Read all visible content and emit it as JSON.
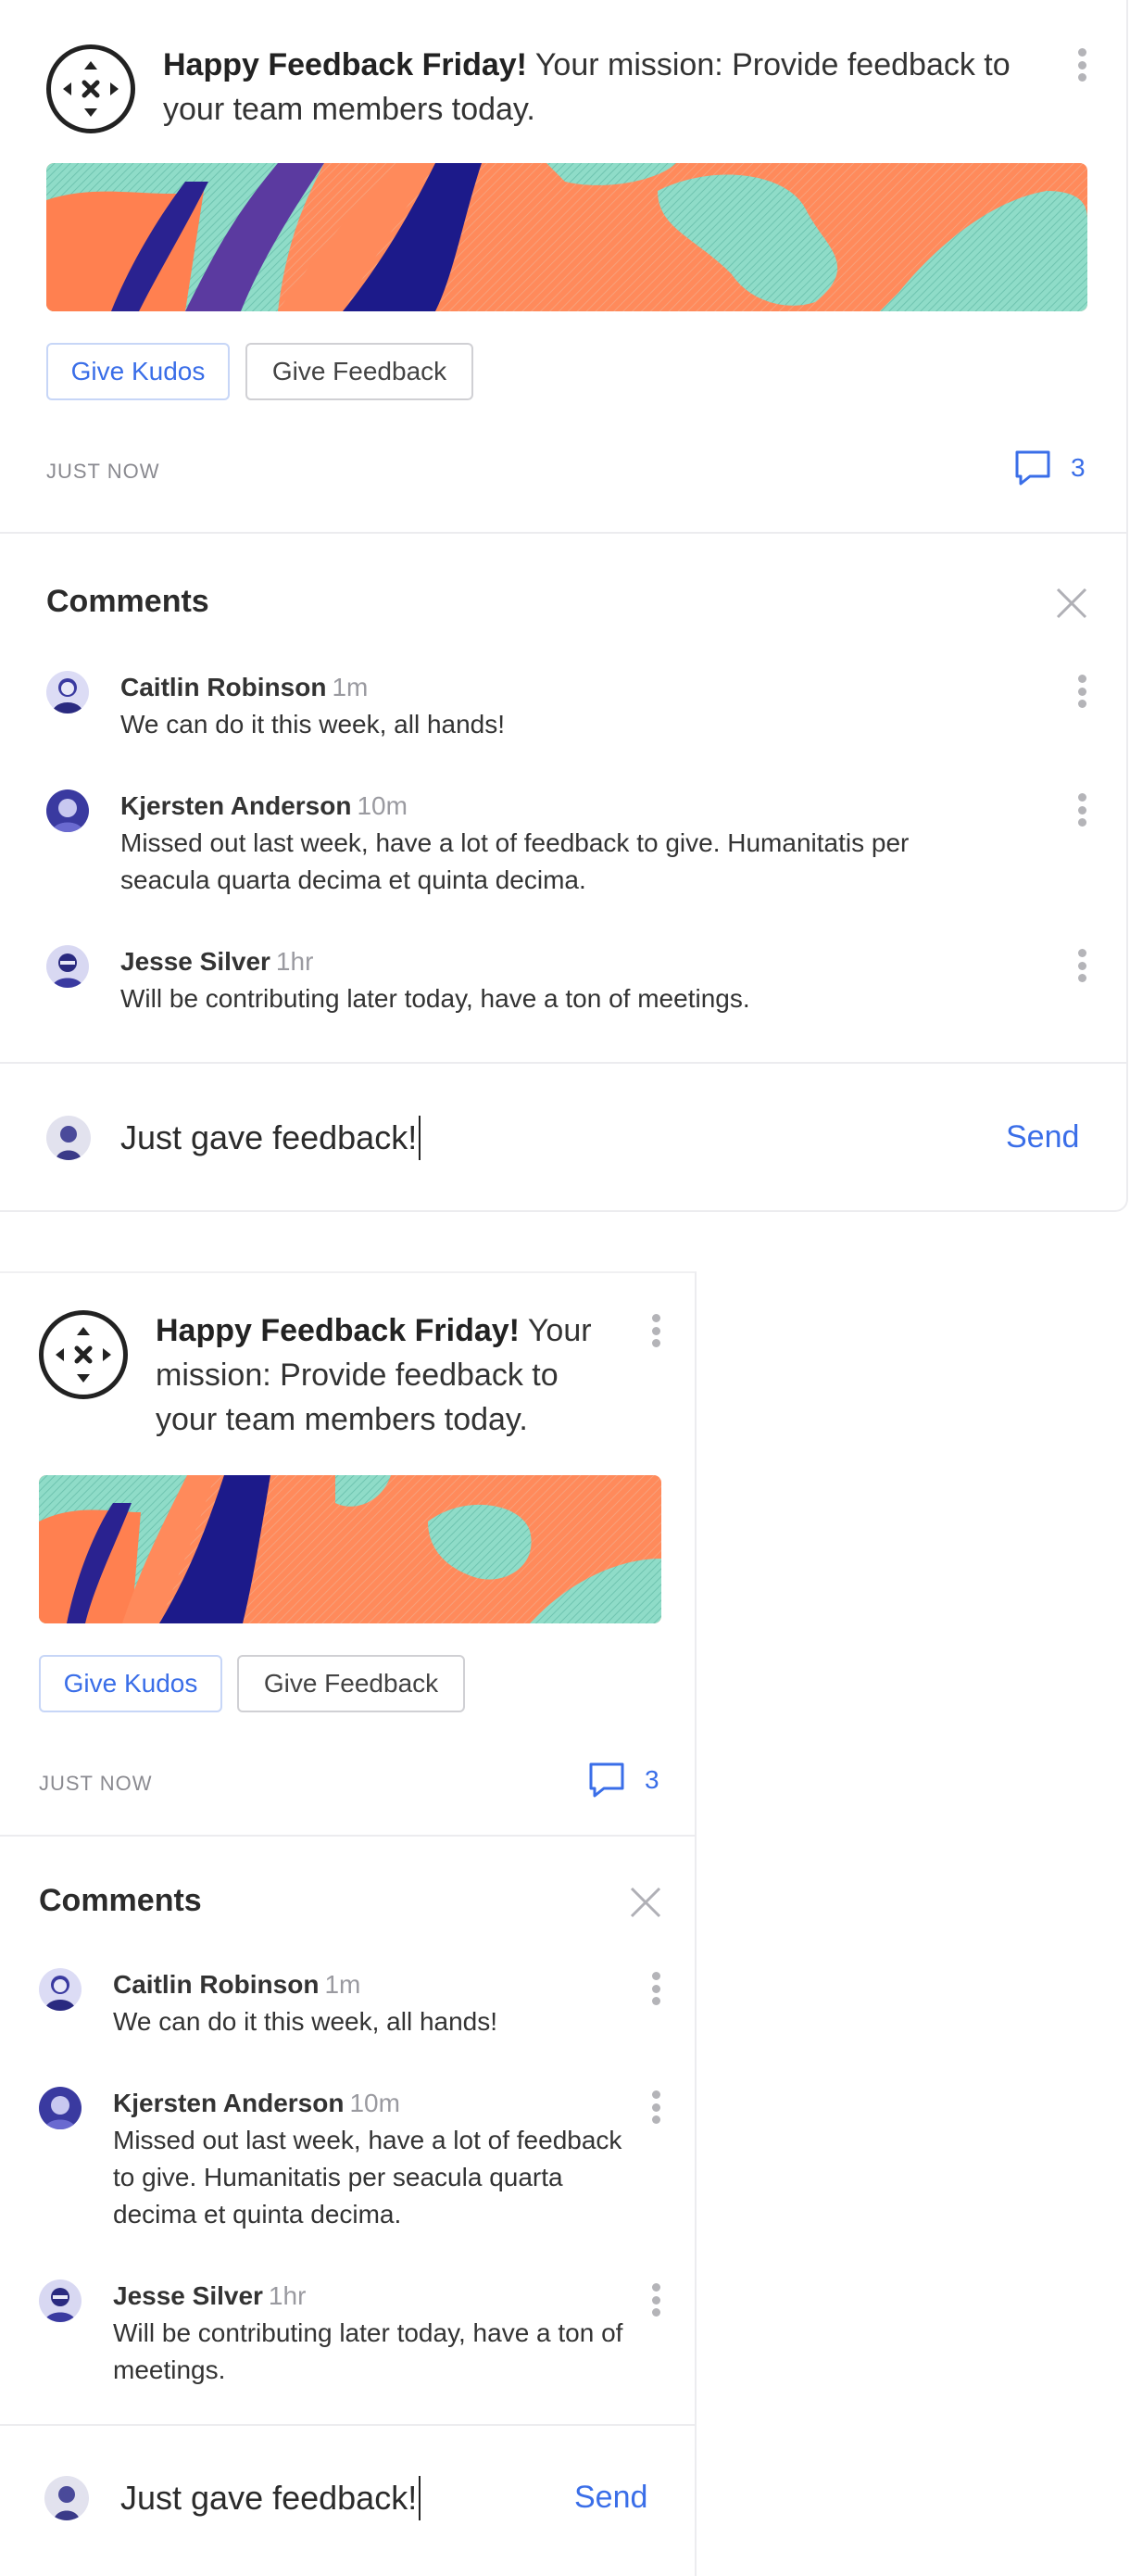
{
  "post": {
    "title_bold": "Happy Feedback Friday!",
    "title_rest": " Your mission: Provide feedback to your team members today.",
    "kudos_label": "Give Kudos",
    "feedback_label": "Give Feedback",
    "timestamp": "JUST NOW",
    "comment_count": "3",
    "logo_icon": "compass-arrows-icon",
    "comment_icon": "speech-bubble-icon",
    "menu_icon": "kebab-menu-icon"
  },
  "comments_panel": {
    "title": "Comments",
    "close_icon": "close-icon",
    "items": [
      {
        "name": "Caitlin Robinson",
        "time": "1m",
        "text": "We can do it this week, all hands!"
      },
      {
        "name": "Kjersten Anderson",
        "time": "10m",
        "text": "Missed out last week, have a lot of feedback to give. Humanitatis per seacula quarta decima et quinta decima."
      },
      {
        "name": "Jesse Silver",
        "time": "1hr",
        "text": "Will be contributing later today, have a ton of meetings."
      }
    ]
  },
  "composer": {
    "value": "Just gave feedback!",
    "send_label": "Send"
  },
  "colors": {
    "accent": "#3a6ee8",
    "banner_orange": "#ff8a5b",
    "banner_navy": "#1c1a8a",
    "banner_teal": "#8fdcc8"
  }
}
